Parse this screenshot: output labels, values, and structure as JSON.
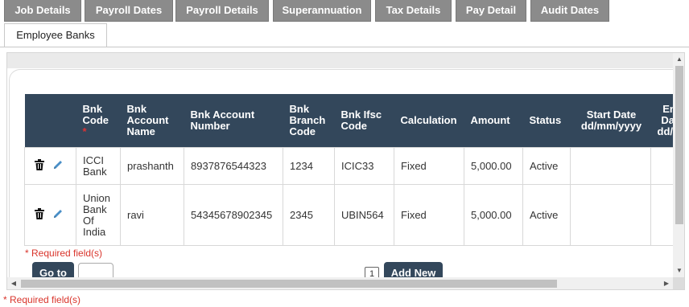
{
  "tabs": [
    "Job Details",
    "Payroll Dates",
    "Payroll Details",
    "Superannuation",
    "Tax Details",
    "Pay Detail",
    "Audit Dates"
  ],
  "active_tab": "Employee Banks",
  "table": {
    "headers": {
      "bnk_code": "Bnk Code",
      "required_star": "*",
      "account_name": "Bnk Account Name",
      "account_number": "Bnk Account Number",
      "branch_code": "Bnk Branch Code",
      "ifsc_code": "Bnk Ifsc Code",
      "calculation": "Calculation",
      "amount": "Amount",
      "status": "Status",
      "start_date": "Start Date dd/mm/yyyy",
      "end_date": "End Date dd/mm/yyyy"
    },
    "rows": [
      {
        "bnk_code": "ICCI Bank",
        "account_name": "prashanth",
        "account_number": "8937876544323",
        "branch_code": "1234",
        "ifsc_code": "ICIC33",
        "calculation": "Fixed",
        "amount": "5,000.00",
        "status": "Active",
        "start_date": "",
        "end_date": ""
      },
      {
        "bnk_code": "Union Bank Of India",
        "account_name": "ravi",
        "account_number": "54345678902345",
        "branch_code": "2345",
        "ifsc_code": "UBIN564",
        "calculation": "Fixed",
        "amount": "5,000.00",
        "status": "Active",
        "start_date": "",
        "end_date": ""
      }
    ]
  },
  "required_note": "* Required field(s)",
  "goto_label": "Go to",
  "page_number": "1",
  "add_new_label": "Add New",
  "icons": {
    "delete": "trash-icon",
    "edit": "pencil-icon"
  },
  "colors": {
    "tab_bg": "#8b8b8b",
    "header_bg": "#33475b",
    "required": "#d9342b",
    "edit_icon": "#4a8fc7"
  }
}
